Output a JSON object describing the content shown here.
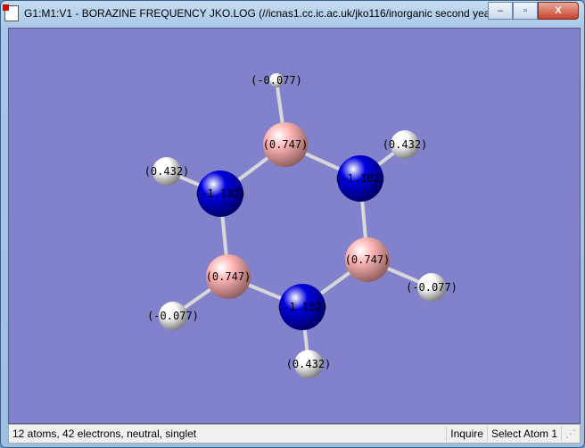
{
  "window": {
    "title": "G1:M1:V1 - BORAZINE FREQUENCY JKO.LOG (//icnas1.cc.ic.ac.uk/jko116/inorganic second year ...",
    "minimize": "–",
    "maximize": "▫",
    "close": "X"
  },
  "molecule": {
    "atoms": [
      {
        "element": "H",
        "charge": "(-0.077)"
      },
      {
        "element": "B",
        "charge": "(0.747)"
      },
      {
        "element": "N",
        "charge": "(-1.102)"
      },
      {
        "element": "H",
        "charge": "(0.432)"
      },
      {
        "element": "B",
        "charge": "(0.747)"
      },
      {
        "element": "H",
        "charge": "(-0.077)"
      },
      {
        "element": "N",
        "charge": "(-1.102)"
      },
      {
        "element": "H",
        "charge": "(0.432)"
      },
      {
        "element": "B",
        "charge": "(0.747)"
      },
      {
        "element": "H",
        "charge": "(-0.077)"
      },
      {
        "element": "N",
        "charge": "(-1.102)"
      },
      {
        "element": "H",
        "charge": "(0.432)"
      }
    ],
    "colors": {
      "H": "#ffffff",
      "B": "#ffb5b5",
      "N": "#0000e0",
      "background": "#8282cc"
    }
  },
  "status": {
    "message": "12 atoms, 42 electrons, neutral, singlet",
    "mode": "Inquire",
    "action": "Select Atom 1"
  }
}
